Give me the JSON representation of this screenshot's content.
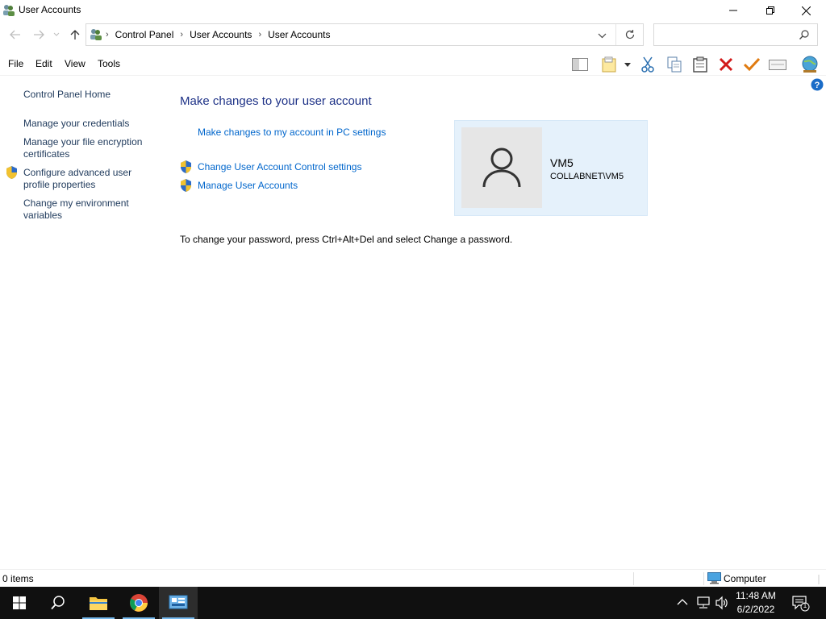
{
  "window": {
    "title": "User Accounts"
  },
  "address": {
    "crumbs": [
      "Control Panel",
      "User Accounts",
      "User Accounts"
    ],
    "search_placeholder": ""
  },
  "menu": {
    "items": [
      "File",
      "Edit",
      "View",
      "Tools"
    ]
  },
  "left_pane": {
    "home": "Control Panel Home",
    "links": [
      "Manage your credentials",
      "Manage your file encryption certificates",
      "Configure advanced user profile properties",
      "Change my environment variables"
    ]
  },
  "main": {
    "heading": "Make changes to your user account",
    "pc_settings_link": "Make changes to my account in PC settings",
    "uac_link": "Change User Account Control settings",
    "manage_link": "Manage User Accounts",
    "password_note": "To change your password, press Ctrl+Alt+Del and select Change a password."
  },
  "user": {
    "name": "VM5",
    "domain": "COLLABNET\\VM5"
  },
  "statusbar": {
    "items": "0 items",
    "location": "Computer"
  },
  "taskbar": {
    "time": "11:48 AM",
    "date": "6/2/2022",
    "notification_count": "1"
  },
  "colors": {
    "link": "#0066cc",
    "heading": "#1e3287",
    "card_bg": "#e5f1fb",
    "taskbar": "#101010"
  }
}
